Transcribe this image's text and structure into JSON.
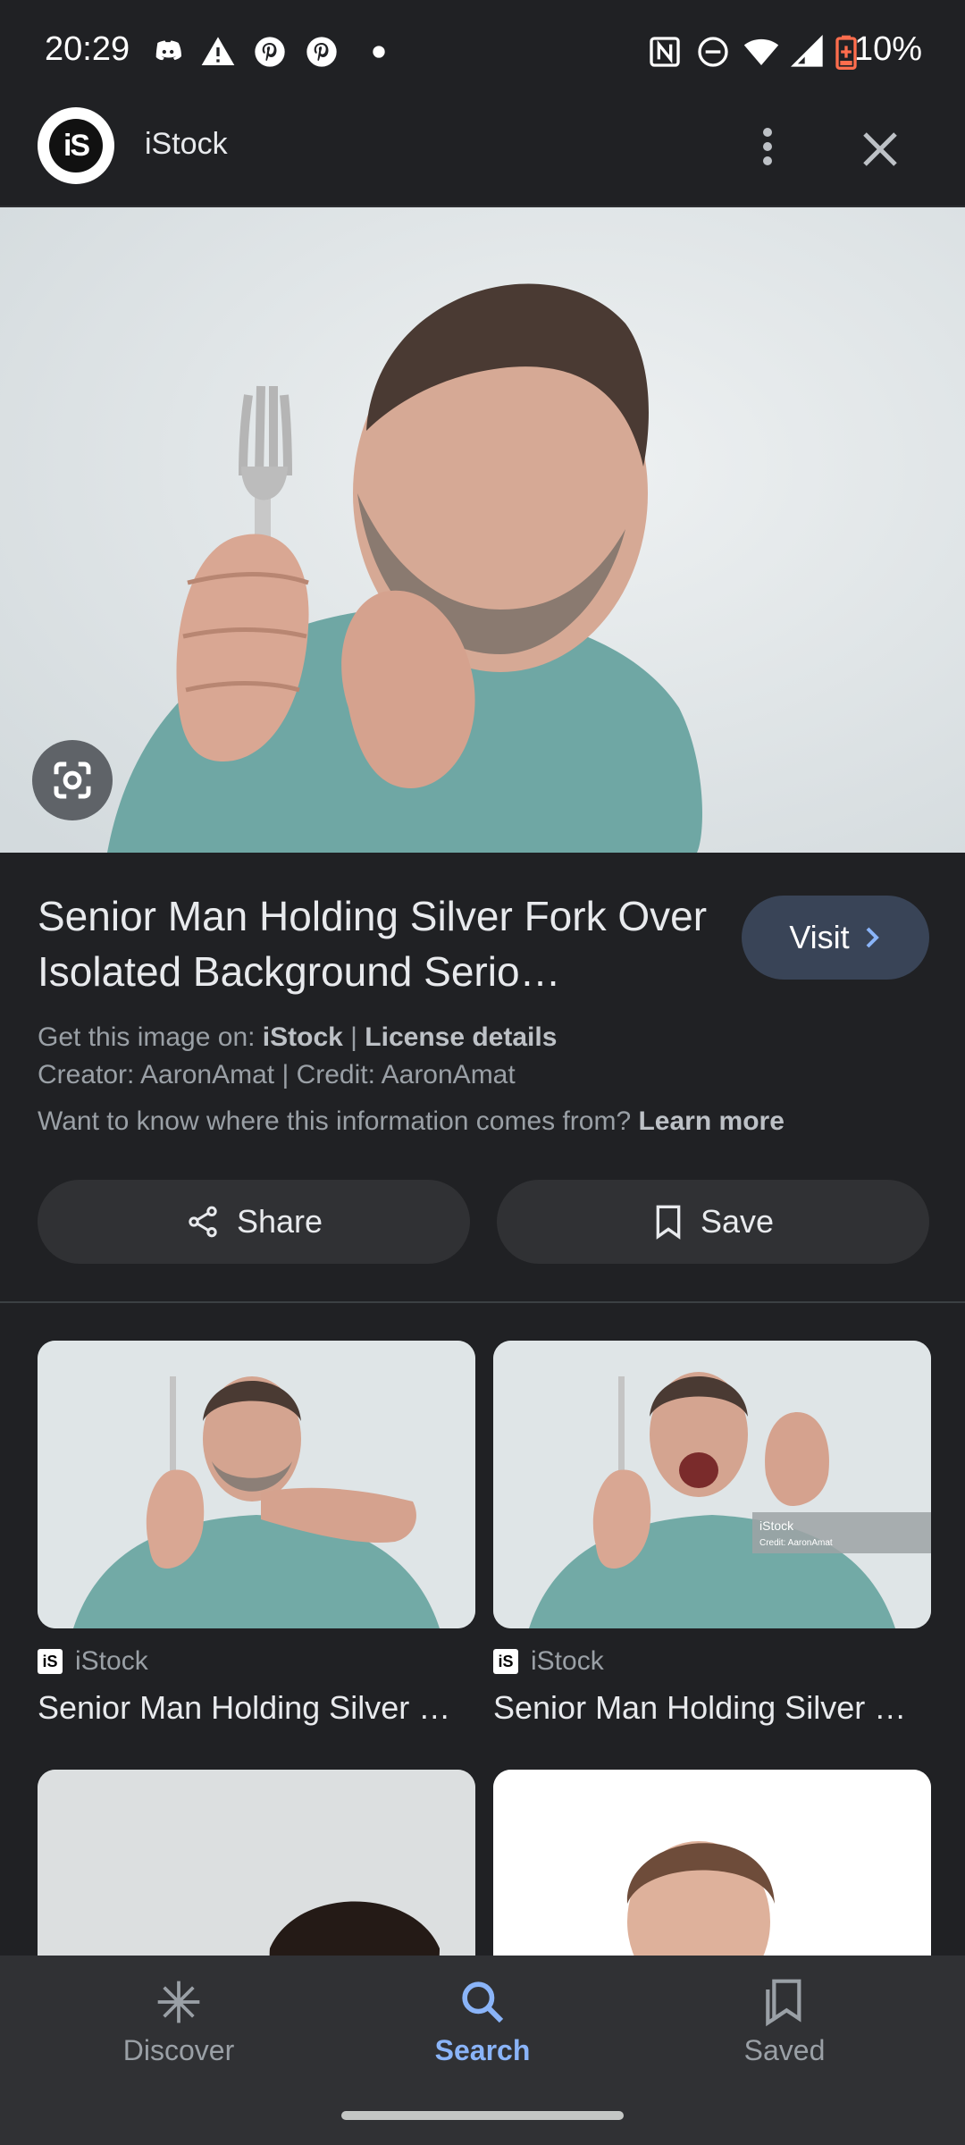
{
  "status_bar": {
    "time": "20:29",
    "battery": "10%"
  },
  "header": {
    "title": "iStock",
    "logo_text": "iS"
  },
  "result": {
    "title": "Senior Man Holding Silver Fork Over Isolated Background Serio…",
    "visit_label": "Visit",
    "get_image_prefix": "Get this image on: ",
    "source_name": "iStock",
    "separator": " | ",
    "license_details": "License details",
    "creator_line": "Creator: AaronAmat | Credit: AaronAmat",
    "info_question": "Want to know where this information comes from? ",
    "learn_more": "Learn more"
  },
  "actions": {
    "share_label": "Share",
    "save_label": "Save"
  },
  "related": [
    {
      "source": "iStock",
      "title": "Senior Man Holding Silver …"
    },
    {
      "source": "iStock",
      "title": "Senior Man Holding Silver …"
    }
  ],
  "thumb_overlay": {
    "brand": "iStock",
    "credit": "Credit: AaronAmat"
  },
  "bottom_nav": {
    "discover": "Discover",
    "search": "Search",
    "saved": "Saved"
  },
  "colors": {
    "background": "#202124",
    "accent": "#8ab4f8",
    "visit_button": "#394457"
  }
}
